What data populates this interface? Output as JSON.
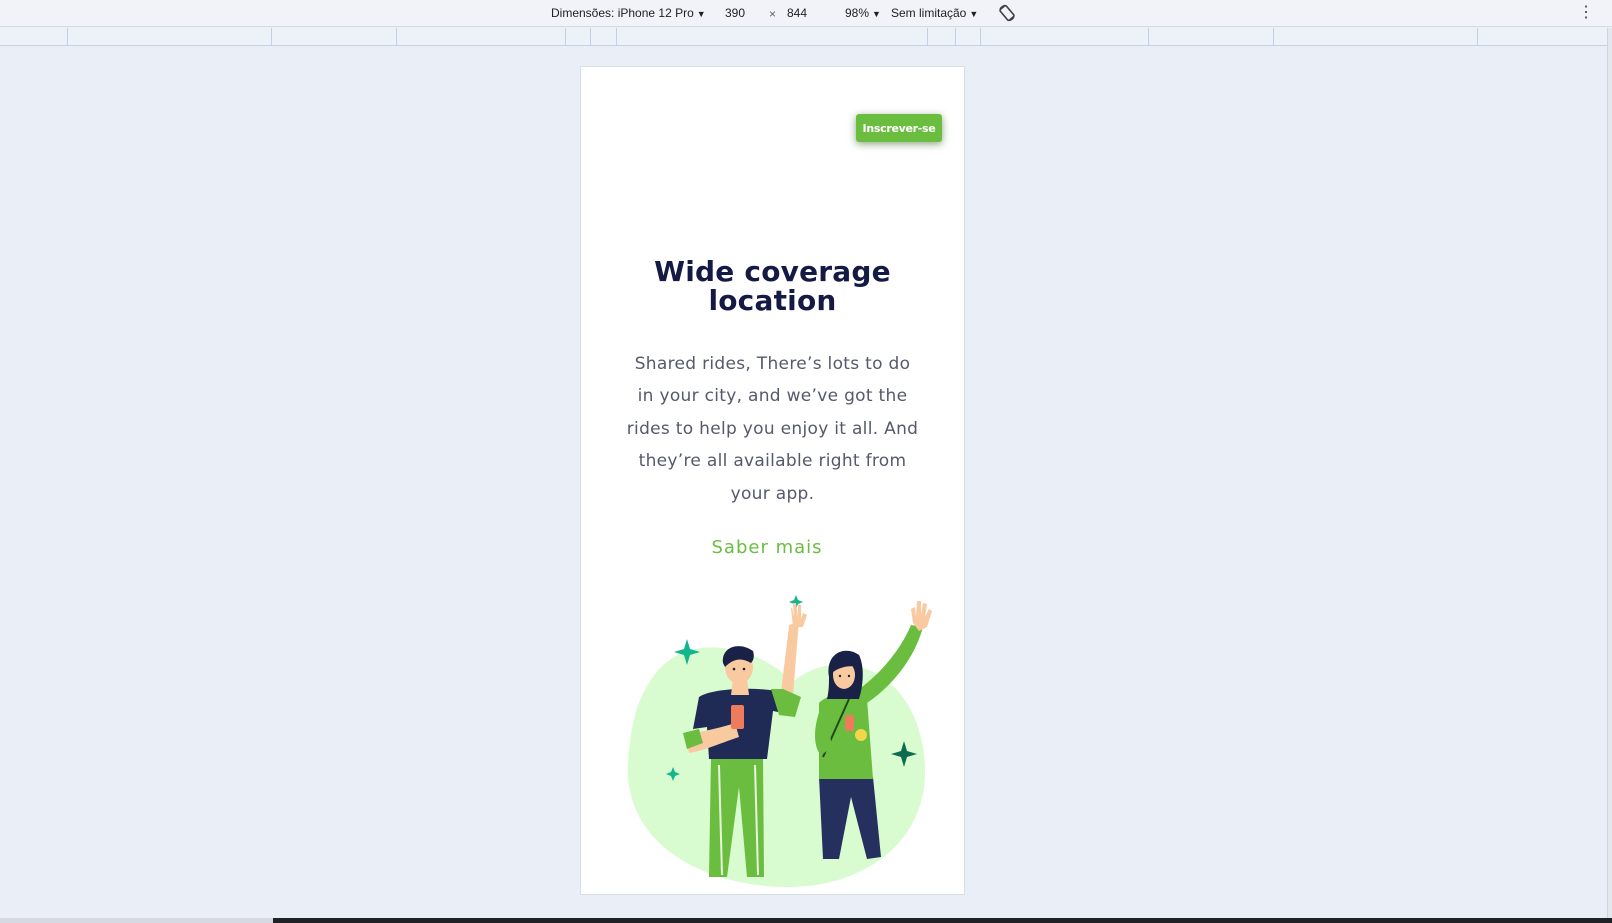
{
  "devtools": {
    "dimensions_label": "Dimensões: iPhone 12 Pro",
    "width": "390",
    "separator": "×",
    "height": "844",
    "zoom": "98%",
    "throttling": "Sem limitação",
    "rotate_icon": "rotate-icon",
    "more_icon": "more-vert-icon"
  },
  "page": {
    "signup_button": "Inscrever-se",
    "title_line1": "Wide coverage",
    "title_line2": "location",
    "description": "Shared rides, There’s lots to do in your city, and we’ve got the rides to help you enjoy it all. And they’re all available right from your app.",
    "learn_more": "Saber mais",
    "illustration": "people-waving-illustration"
  },
  "colors": {
    "accent": "#6bbd3f",
    "heading": "#141a44",
    "body_text": "#55596b",
    "blob": "#d9fbd0",
    "sparkle": "#13b58a"
  }
}
